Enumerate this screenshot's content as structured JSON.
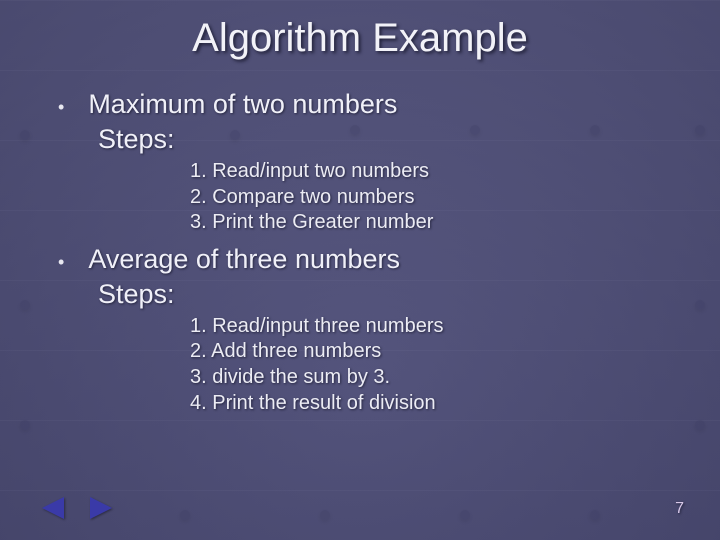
{
  "title": "Algorithm Example",
  "blocks": [
    {
      "bullet": "Maximum of two numbers",
      "steps_label": "Steps:",
      "steps": [
        "1. Read/input two numbers",
        "2. Compare two numbers",
        "3. Print the Greater number"
      ]
    },
    {
      "bullet": "Average of three numbers",
      "steps_label": "Steps:",
      "steps": [
        "1. Read/input three numbers",
        "2. Add three numbers",
        "3. divide the sum by 3.",
        "4. Print the result of division"
      ]
    }
  ],
  "page_number": "7"
}
